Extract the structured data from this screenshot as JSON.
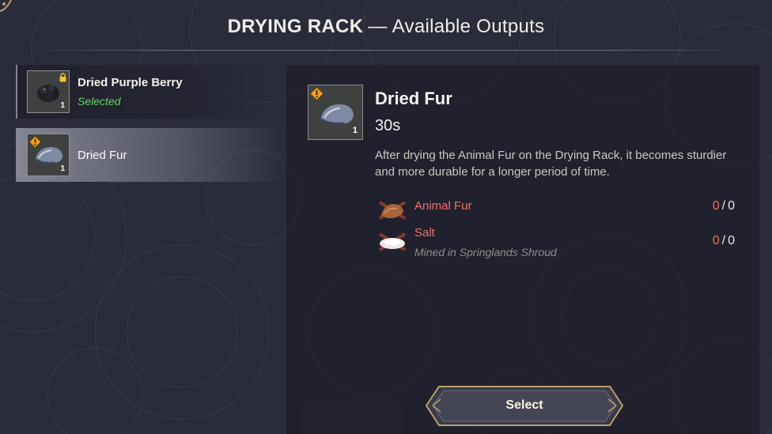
{
  "header": {
    "title_main": "DRYING RACK",
    "title_dash": "—",
    "title_sub": "Available Outputs"
  },
  "recipes": [
    {
      "name": "Dried Purple Berry",
      "status": "Selected",
      "qty": "1",
      "icon": "dried-purple-berry-icon",
      "locked": true
    },
    {
      "name": "Dried Fur",
      "qty": "1",
      "icon": "dried-fur-icon",
      "warning": true
    }
  ],
  "detail": {
    "name": "Dried Fur",
    "qty": "1",
    "time": "30s",
    "icon": "dried-fur-icon",
    "description": "After drying the Animal Fur on the Drying Rack, it becomes sturdier and more durable for a longer period of time.",
    "materials": [
      {
        "name": "Animal Fur",
        "have": "0",
        "need": "0",
        "icon": "animal-fur-icon"
      },
      {
        "name": "Salt",
        "hint": "Mined in Springlands Shroud",
        "have": "0",
        "need": "0",
        "icon": "salt-icon"
      }
    ],
    "count_separator": "/"
  },
  "actions": {
    "select_label": "Select"
  },
  "colors": {
    "background": "#2b2c3a",
    "missing": "#f16f66",
    "selected": "#5fd463",
    "warning": "#f0a21a",
    "button_gold": "#b9a069"
  }
}
